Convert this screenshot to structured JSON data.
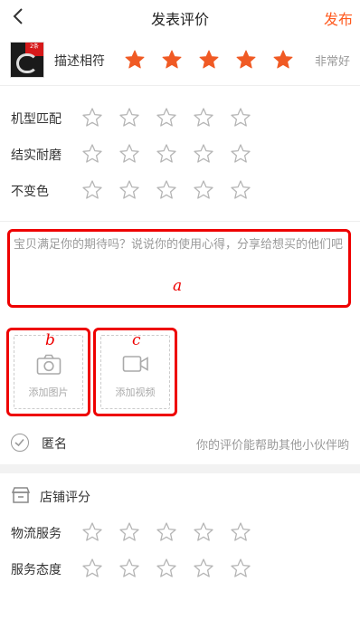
{
  "header": {
    "title": "发表评价",
    "publish_label": "发布"
  },
  "product": {
    "badge": "2条",
    "label": "描述相符",
    "stars_filled": 5,
    "rating_text": "非常好"
  },
  "attributes": [
    {
      "label": "机型匹配",
      "stars_filled": 0
    },
    {
      "label": "结实耐磨",
      "stars_filled": 0
    },
    {
      "label": "不变色",
      "stars_filled": 0
    }
  ],
  "review": {
    "placeholder": "宝贝满足你的期待吗？说说你的使用心得，分享给想买的他们吧"
  },
  "annotations": {
    "a": "a",
    "b": "b",
    "c": "c"
  },
  "media": {
    "photo_label": "添加图片",
    "video_label": "添加视频"
  },
  "anonymous": {
    "label": "匿名",
    "hint": "你的评价能帮助其他小伙伴哟"
  },
  "shop": {
    "title": "店铺评分",
    "ratings": [
      {
        "label": "物流服务",
        "stars_filled": 0
      },
      {
        "label": "服务态度",
        "stars_filled": 0
      }
    ]
  },
  "colors": {
    "accent": "#ff5a1f",
    "star_filled": "#f05a24",
    "star_empty": "#b5b5b5",
    "annotation": "#ee0000"
  }
}
